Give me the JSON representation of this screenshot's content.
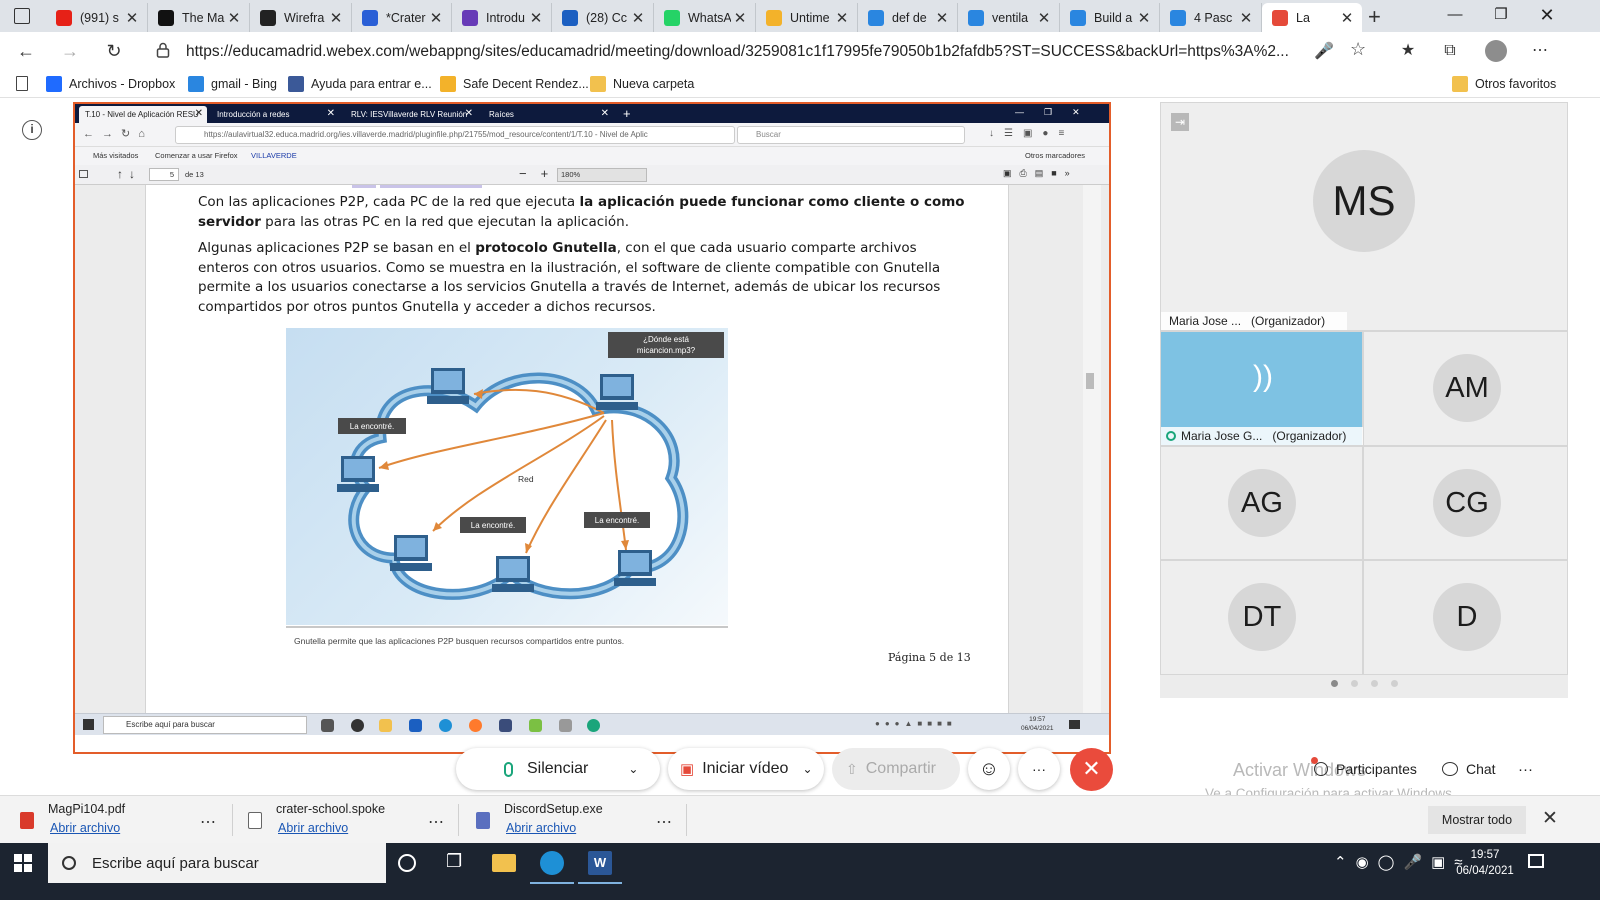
{
  "browser": {
    "tabs": [
      {
        "label": "(991) s",
        "favicon": "youtube-icon",
        "color": "#e62117"
      },
      {
        "label": "The Ma",
        "favicon": "m-logo-icon",
        "color": "#111111"
      },
      {
        "label": "Wirefra",
        "favicon": "github-icon",
        "color": "#222222"
      },
      {
        "label": "*Crater",
        "favicon": "globe-icon",
        "color": "#2a5fd6"
      },
      {
        "label": "Introdu",
        "favicon": "form-icon",
        "color": "#673ab7"
      },
      {
        "label": "(28) Cc",
        "favicon": "mail-icon",
        "color": "#1b5fc1"
      },
      {
        "label": "WhatsA",
        "favicon": "whatsapp-icon",
        "color": "#25d366"
      },
      {
        "label": "Untime",
        "favicon": "emoji-icon",
        "color": "#f3b22a"
      },
      {
        "label": "def de",
        "favicon": "bing-icon",
        "color": "#2a86e0"
      },
      {
        "label": "ventila",
        "favicon": "bing-icon",
        "color": "#2a86e0"
      },
      {
        "label": "Build a",
        "favicon": "bing-icon",
        "color": "#2a86e0"
      },
      {
        "label": "4 Pasc",
        "favicon": "bing-icon",
        "color": "#2a86e0"
      },
      {
        "label": "La",
        "favicon": "webex-icon",
        "color": "#e54a3a"
      }
    ],
    "new_tab": "+",
    "url": "https://educamadrid.webex.com/webappng/sites/educamadrid/meeting/download/3259081c1f17995fe79050b1b2fafdb5?ST=SUCCESS&backUrl=https%3A%2...",
    "bookmarks": [
      {
        "label": "Archivos - Dropbox",
        "icon": "dropbox-icon",
        "color": "#1f6bff"
      },
      {
        "label": "gmail - Bing",
        "icon": "bing-icon",
        "color": "#2a86e0"
      },
      {
        "label": "Ayuda para entrar e...",
        "icon": "facebook-icon",
        "color": "#3b5998"
      },
      {
        "label": "Safe Decent Rendez...",
        "icon": "emoji-icon",
        "color": "#f3b22a"
      },
      {
        "label": "Nueva carpeta",
        "icon": "folder-icon",
        "color": "#f2c14e"
      }
    ],
    "other_favorites": "Otros favoritos"
  },
  "shared_screen": {
    "tabs": [
      "T.10 - Nivel de Aplicación RESU",
      "Introducción a redes",
      "RLV: IESVillaverde RLV Reunión",
      "Raíces"
    ],
    "url": "https://aulavirtual32.educa.madrid.org/ies.villaverde.madrid/pluginfile.php/21755/mod_resource/content/1/T.10 - Nivel de Aplic",
    "search_placeholder": "Buscar",
    "bookmarks": [
      "Más visitados",
      "Comenzar a usar Firefox",
      "VILLAVERDE"
    ],
    "other_bookmarks": "Otros marcadores",
    "pdf": {
      "page_current": "5",
      "page_total": "de 13",
      "zoom": "180%",
      "para1_a": "Con las aplicaciones P2P, cada PC de la red que ejecuta ",
      "para1_b": "la aplicación puede funcionar como cliente o como servidor",
      "para1_c": " para las otras PC en la red que ejecutan la aplicación.",
      "para2_a": "Algunas aplicaciones P2P se basan en el ",
      "para2_b": "protocolo Gnutella",
      "para2_c": ", con el que cada usuario comparte archivos enteros con otros usuarios. Como se muestra en la ilustración, el software de cliente compatible con Gnutella permite a los usuarios conectarse a los servicios Gnutella a través de Internet, además de ubicar los recursos compartidos por otros puntos Gnutella y acceder a dichos recursos.",
      "figure": {
        "question_line1": "¿Dónde está",
        "question_line2": "micancion.mp3?",
        "found_label": "La encontré.",
        "network_label": "Red"
      },
      "caption": "Gnutella permite que las aplicaciones P2P busquen recursos compartidos entre puntos.",
      "page_footer": "Página 5 de 13"
    },
    "taskbar": {
      "search_placeholder": "Escribe aquí para buscar",
      "time": "19:57",
      "date": "06/04/2021"
    }
  },
  "participants": {
    "main": {
      "initials": "MS",
      "name": "Maria Jose ...",
      "role": "(Organizador)"
    },
    "active": {
      "name": "Maria Jose G...",
      "role": "(Organizador)"
    },
    "tiles": [
      {
        "initials": "AM"
      },
      {
        "initials": "AG"
      },
      {
        "initials": "CG"
      },
      {
        "initials": "DT"
      },
      {
        "initials": "D"
      }
    ]
  },
  "controls": {
    "mute": "Silenciar",
    "video": "Iniciar vídeo",
    "share": "Compartir",
    "participants": "Participantes",
    "chat": "Chat",
    "more": "···"
  },
  "watermark": {
    "line1": "Activar Windows",
    "line2": "Ve a Configuración para activar Windows."
  },
  "downloads": {
    "items": [
      {
        "name": "MagPi104.pdf",
        "action": "Abrir archivo",
        "icon": "pdf-icon"
      },
      {
        "name": "crater-school.spoke",
        "action": "Abrir archivo",
        "icon": "file-icon"
      },
      {
        "name": "DiscordSetup.exe",
        "action": "Abrir archivo",
        "icon": "exe-icon"
      }
    ],
    "show_all": "Mostrar todo"
  },
  "taskbar": {
    "search_placeholder": "Escribe aquí para buscar",
    "time": "19:57",
    "date": "06/04/2021"
  }
}
